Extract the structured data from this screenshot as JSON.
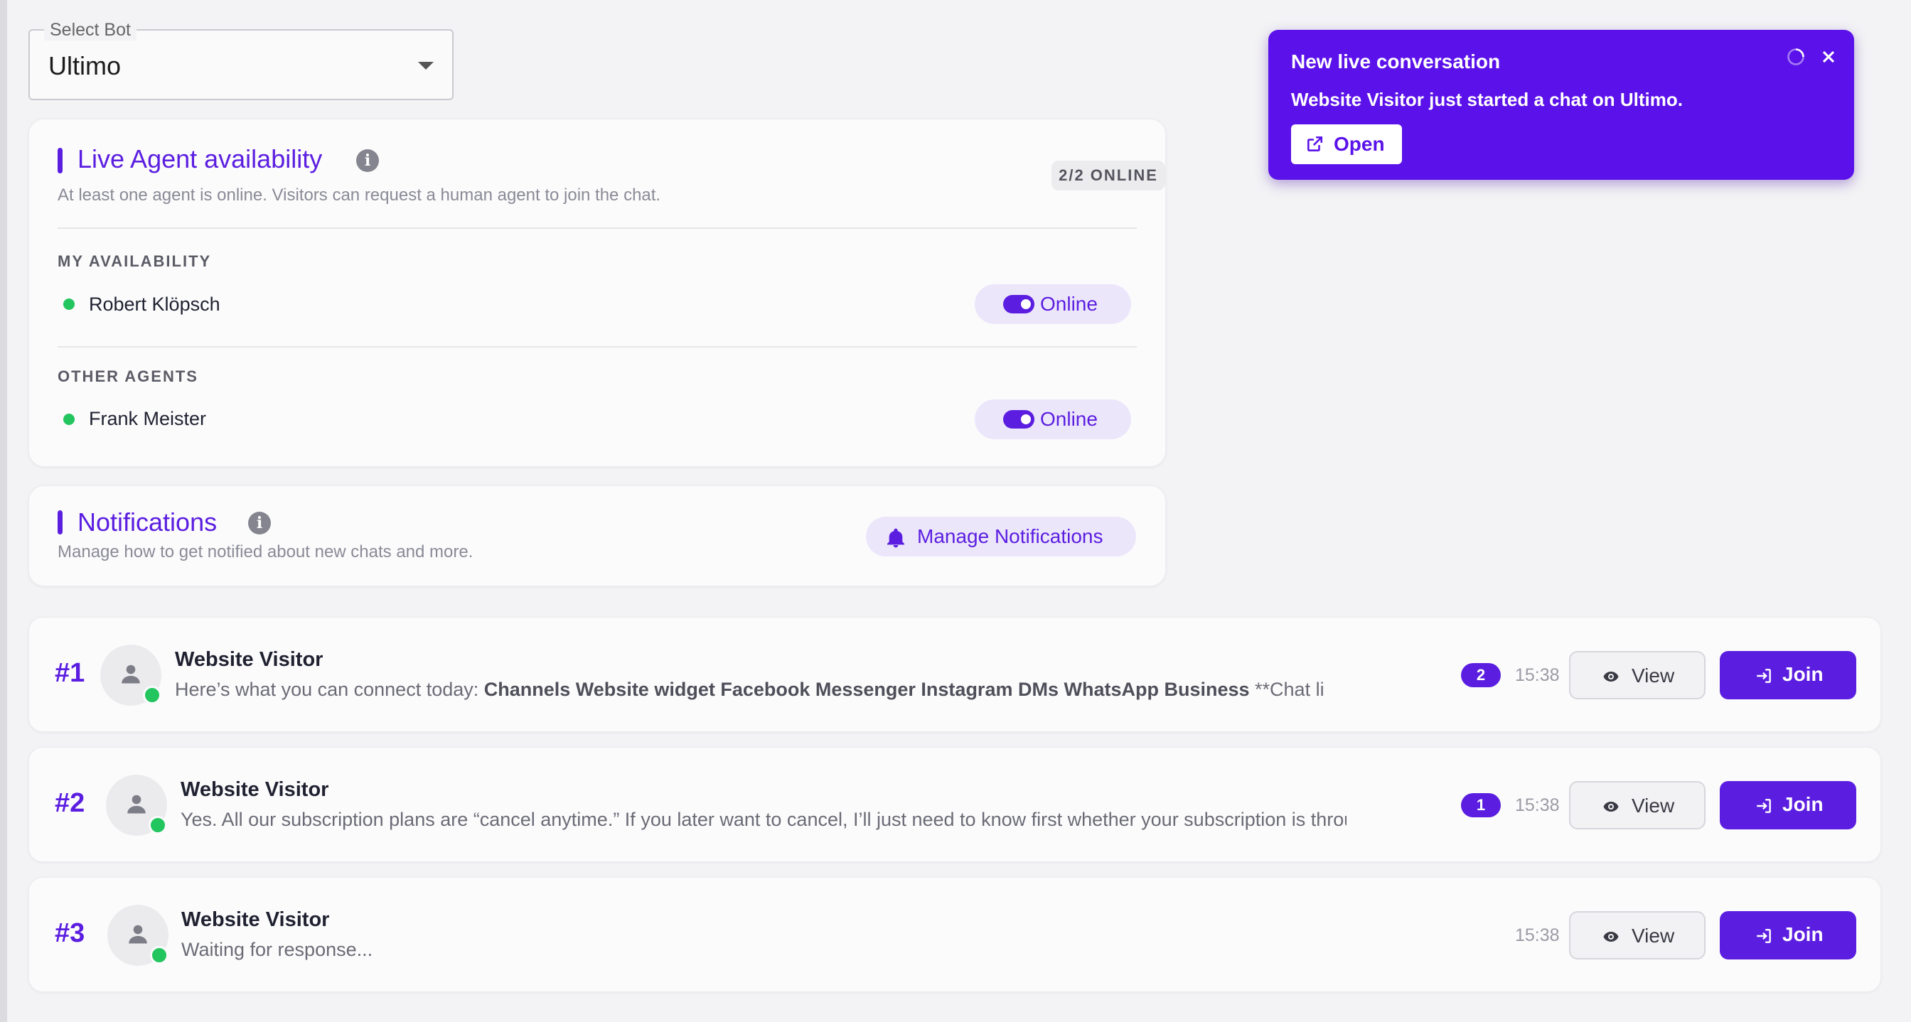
{
  "select_bot": {
    "label": "Select Bot",
    "value": "Ultimo"
  },
  "availability": {
    "title": "Live Agent availability",
    "subtitle": "At least one agent is online. Visitors can request a human agent to join the chat.",
    "online_count": "2/2 ONLINE",
    "my_section": "MY AVAILABILITY",
    "me": {
      "name": "Robert Klöpsch",
      "status": "Online"
    },
    "other_section": "OTHER AGENTS",
    "others": [
      {
        "name": "Frank Meister",
        "status": "Online"
      }
    ]
  },
  "notifications": {
    "title": "Notifications",
    "subtitle": "Manage how to get notified about new chats and more.",
    "manage_label": "Manage Notifications"
  },
  "chats": [
    {
      "num": "#1",
      "name": "Website Visitor",
      "preview_plain": "Here’s what you can connect today: ",
      "preview_bold": "Channels Website widget Facebook Messenger Instagram DMs WhatsApp Business",
      "preview_tail": " **Chat li",
      "unread": "2",
      "time": "15:38",
      "view_label": "View",
      "join_label": "Join"
    },
    {
      "num": "#2",
      "name": "Website Visitor",
      "preview_plain": "Yes. All our subscription plans are “cancel anytime.” If you later want to cancel, I’ll just need to know first whether your subscription is through",
      "unread": "1",
      "time": "15:38",
      "view_label": "View",
      "join_label": "Join"
    },
    {
      "num": "#3",
      "name": "Website Visitor",
      "preview_plain": "Waiting for response...",
      "time": "15:38",
      "view_label": "View",
      "join_label": "Join"
    }
  ],
  "toast": {
    "title": "New live conversation",
    "body": "Website Visitor just started a chat on Ultimo.",
    "open_label": "Open"
  },
  "colors": {
    "accent": "#5b1ee0",
    "toast_bg": "#5b12ea",
    "online": "#22c55e"
  },
  "icons": [
    "info-icon",
    "bell-icon",
    "user-icon",
    "eye-icon",
    "join-arrow-icon",
    "external-link-icon",
    "spinner-icon",
    "close-icon",
    "chevron-down-icon"
  ]
}
